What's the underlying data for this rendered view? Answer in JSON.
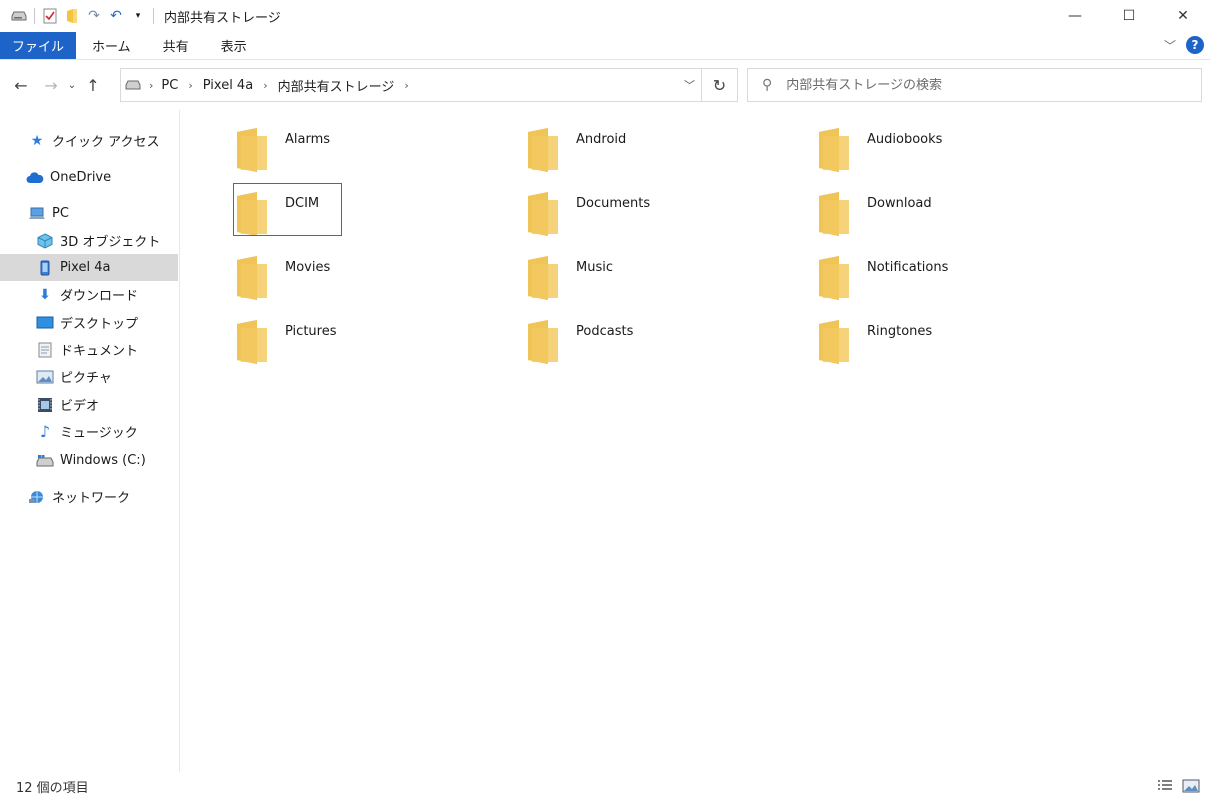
{
  "window": {
    "title": "内部共有ストレージ",
    "controls": {
      "minimize": "—",
      "maximize": "☐",
      "close": "✕"
    }
  },
  "ribbon": {
    "tabs": [
      "ファイル",
      "ホーム",
      "共有",
      "表示"
    ]
  },
  "address": {
    "crumbs": [
      "PC",
      "Pixel 4a",
      "内部共有ストレージ"
    ]
  },
  "search": {
    "placeholder": "内部共有ストレージの検索"
  },
  "sidebar": {
    "items": [
      {
        "label": "クイック アクセス",
        "icon": "star-icon"
      },
      {
        "label": "OneDrive",
        "icon": "cloud-icon"
      },
      {
        "label": "PC",
        "icon": "computer-icon"
      },
      {
        "label": "3D オブジェクト",
        "icon": "cube-icon"
      },
      {
        "label": "Pixel 4a",
        "icon": "phone-icon",
        "selected": true
      },
      {
        "label": "ダウンロード",
        "icon": "download-icon"
      },
      {
        "label": "デスクトップ",
        "icon": "desktop-icon"
      },
      {
        "label": "ドキュメント",
        "icon": "document-icon"
      },
      {
        "label": "ピクチャ",
        "icon": "picture-icon"
      },
      {
        "label": "ビデオ",
        "icon": "video-icon"
      },
      {
        "label": "ミュージック",
        "icon": "music-icon"
      },
      {
        "label": "Windows (C:)",
        "icon": "drive-icon"
      },
      {
        "label": "ネットワーク",
        "icon": "network-icon"
      }
    ]
  },
  "folders": [
    "Alarms",
    "Android",
    "Audiobooks",
    "DCIM",
    "Documents",
    "Download",
    "Movies",
    "Music",
    "Notifications",
    "Pictures",
    "Podcasts",
    "Ringtones"
  ],
  "highlighted_folder": "DCIM",
  "status": {
    "item_count": "12 個の項目"
  },
  "colors": {
    "accent": "#1e64c8",
    "folder": "#f5cf6e",
    "highlight": "#e03030",
    "selected": "#d9d9d9"
  }
}
